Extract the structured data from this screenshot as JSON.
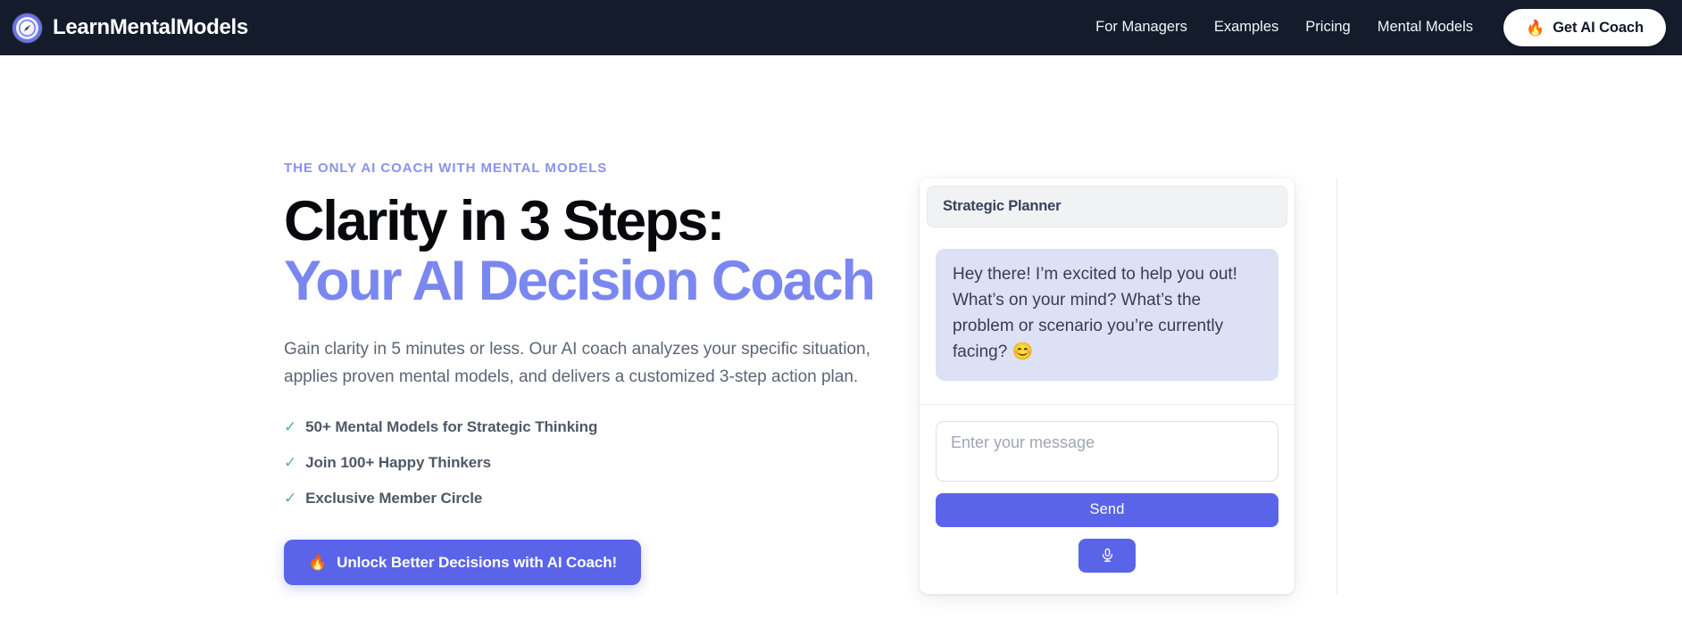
{
  "brand": {
    "name": "LearnMentalModels",
    "logo_icon": "compass-icon"
  },
  "nav": {
    "links": [
      {
        "label": "For Managers"
      },
      {
        "label": "Examples"
      },
      {
        "label": "Pricing"
      },
      {
        "label": "Mental Models"
      }
    ],
    "cta": {
      "label": "Get AI Coach",
      "icon": "flame-emoji",
      "icon_glyph": "🔥"
    }
  },
  "hero": {
    "eyebrow": "THE ONLY AI COACH WITH MENTAL MODELS",
    "headline_line1": "Clarity in 3 Steps:",
    "headline_line2": "Your AI Decision Coach",
    "subcopy": "Gain clarity in 5 minutes or less. Our AI coach analyzes your specific situation, applies proven mental models, and delivers a customized 3-step action plan.",
    "benefits": [
      {
        "tick": "✓",
        "label": "50+ Mental Models for Strategic Thinking"
      },
      {
        "tick": "✓",
        "label": "Join 100+ Happy Thinkers"
      },
      {
        "tick": "✓",
        "label": "Exclusive Member Circle"
      }
    ],
    "cta": {
      "label": "Unlock Better Decisions with AI Coach!",
      "icon": "flame-emoji",
      "icon_glyph": "🔥"
    }
  },
  "chat": {
    "header_title": "Strategic Planner",
    "messages": [
      {
        "role": "assistant",
        "text": "Hey there! I’m excited to help you out! What’s on your mind? What’s the problem or scenario you’re currently facing? 😊"
      }
    ],
    "input": {
      "placeholder": "Enter your message",
      "value": ""
    },
    "send_label": "Send",
    "mic_icon": "microphone-icon"
  },
  "colors": {
    "header_bg": "#141b2b",
    "accent_indigo": "#5a64e8",
    "accent_periwinkle": "#7b87f0",
    "eyebrow": "#8a93e8",
    "bubble_bg": "#dde1f5",
    "tick_green": "#53b87d",
    "flame_orange": "#f97316",
    "page_bg": "#ffffff"
  }
}
